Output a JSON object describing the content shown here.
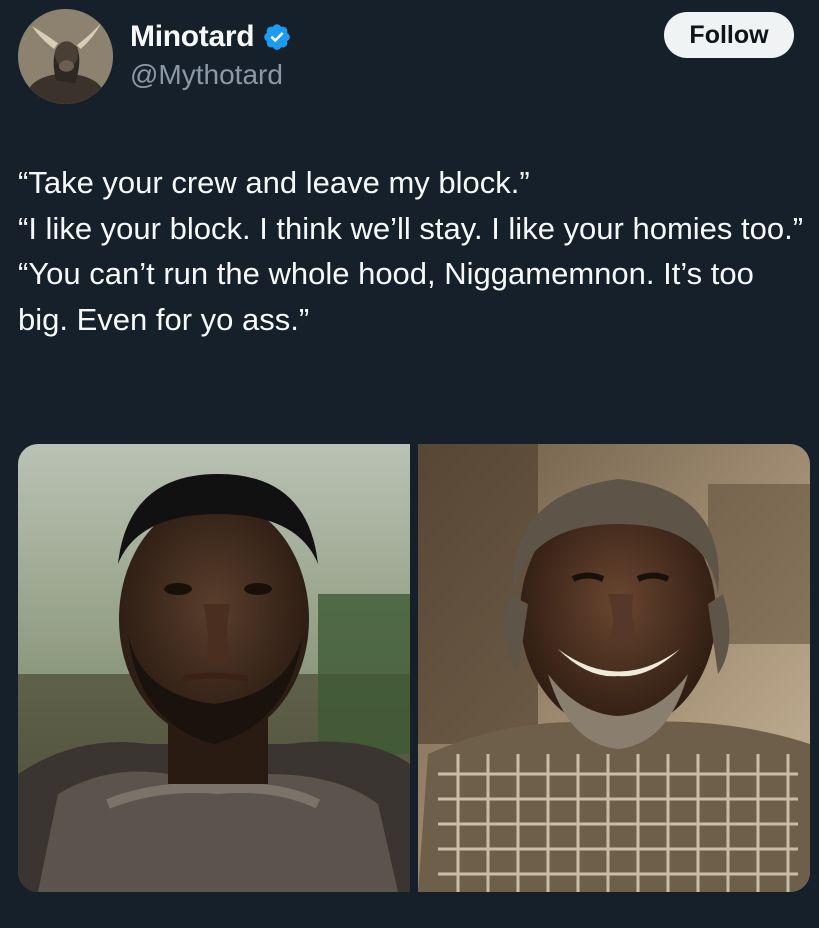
{
  "author": {
    "display_name": "Minotard",
    "handle": "@Mythotard",
    "verified": true,
    "avatar_icon": "minotaur-avatar",
    "verified_color": "#1d9bf0"
  },
  "actions": {
    "follow_label": "Follow"
  },
  "tweet": {
    "lines": [
      "“Take your crew and leave my block.”",
      "“I like your block. I think we’ll stay. I like your homies too.”",
      "“You can’t run the whole hood, Niggamemnon. It’s too big. Even for yo ass.”"
    ]
  },
  "media": {
    "images": [
      {
        "icon": "bearded-warrior-photo"
      },
      {
        "icon": "smiling-warrior-photo"
      }
    ]
  },
  "colors": {
    "background": "#15202b",
    "text": "#f7f9f9",
    "secondary_text": "#8b98a5",
    "button_bg": "#eff3f4",
    "button_text": "#0f1419"
  }
}
